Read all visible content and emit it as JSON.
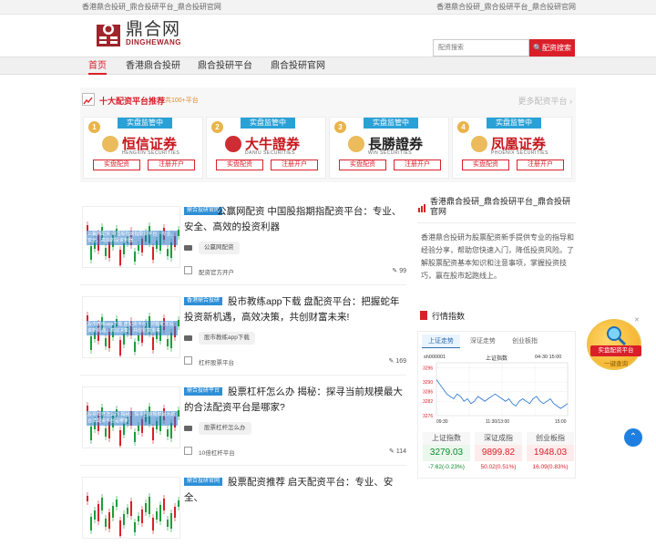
{
  "topbar": {
    "left": "香港鼎合投研_鼎合投研平台_鼎合投研官网",
    "right": "香港鼎合投研_鼎合投研平台_鼎合投研官网"
  },
  "logo": {
    "cn": "鼎合网",
    "en": "DINGHEWANG"
  },
  "search": {
    "placeholder": "配资搜索",
    "button": "🔍配资搜索"
  },
  "nav": [
    "首页",
    "香港鼎合投研",
    "鼎合投研平台",
    "鼎合投研官网"
  ],
  "promo": {
    "title": "十大配资平台推荐",
    "count": "共100+平台",
    "more": "更多配资平台"
  },
  "cards": [
    {
      "num": "1",
      "tag": "实盘监管中",
      "name": "恒信证券",
      "en": "HENGXIN SECURITIES",
      "btn1": "实盘配资",
      "btn2": "注册开户",
      "color": "#c8161d"
    },
    {
      "num": "2",
      "tag": "实盘监管中",
      "name": "大牛證券",
      "en": "DANIU SECURITIES",
      "btn1": "实盘配资",
      "btn2": "注册开户",
      "color": "#c8161d"
    },
    {
      "num": "3",
      "tag": "实盘监管中",
      "name": "長勝證券",
      "en": "WIN SECURITIES",
      "btn1": "实盘配资",
      "btn2": "注册开户",
      "color": "#222"
    },
    {
      "num": "4",
      "tag": "实盘监管中",
      "name": "凤凰证券",
      "en": "PHOENIX SECURITIES",
      "btn1": "实盘配资",
      "btn2": "注册开户",
      "color": "#c8161d"
    }
  ],
  "articles": [
    {
      "badge": "鼎合投研官网",
      "title": "公赢网配资 中国股指期指配资平台：专业、安全、高效的投资利器",
      "thumb": "公赢网配资 中国股指期指配资平台：专业、安全、高效的投资利器",
      "tag": "公赢网配资",
      "source": "配资官方开户",
      "views": "99"
    },
    {
      "badge": "香港鼎合投研",
      "title": "股市教练app下载 盘配资平台：把握蛇年投资新机遇，高效决策，共创财富未来!",
      "thumb": "股市教练app下载 盘配资平台：把握蛇年投资新机遇，高效决策，共创财富未来",
      "tag": "股市教练app下载",
      "source": "杠杆股票平台",
      "views": "169"
    },
    {
      "badge": "鼎合投研平台",
      "title": "股票杠杆怎么办 揭秘：探寻当前规模最大的合法配资平台是哪家?",
      "thumb": "股票杠杆怎么办 揭秘：探寻当前规模最大的合法配资平台是哪家",
      "tag": "股票杠杆怎么办",
      "source": "10倍杠杆平台",
      "views": "114"
    },
    {
      "badge": "鼎合投研官网",
      "title": "股票配资推荐 启天配资平台：专业、安全、",
      "thumb": "",
      "tag": "",
      "source": "",
      "views": ""
    }
  ],
  "sidebar": {
    "title": "香港鼎合投研_鼎合投研平台_鼎合投研官网",
    "text": "香港鼎合投研为股票配资新手提供专业的指导和经验分享，帮助您快速入门，降低投资风险。了解股票配资基本知识和注意事项，掌握投资技巧，赢在股市起跑线上。"
  },
  "market": {
    "title": "行情指数",
    "tabs": [
      "上证走势",
      "深证走势",
      "创业板指"
    ],
    "chart_title": "上证指数",
    "chart_code": "sh000001",
    "chart_time": "04-30 15:00",
    "chart_data": {
      "type": "line",
      "title": "上证指数",
      "ylim": [
        3276,
        3298
      ],
      "yticks": [
        "3296",
        "3290",
        "3286",
        "3282",
        "3276"
      ],
      "xticks": [
        "09:30",
        "11:30/13:00",
        "15:00"
      ],
      "values": [
        3291,
        3289,
        3287,
        3285,
        3284,
        3283,
        3285,
        3284,
        3282,
        3283,
        3281,
        3282,
        3284,
        3283,
        3282,
        3283,
        3284,
        3285,
        3284,
        3283,
        3282,
        3283,
        3281,
        3280,
        3282,
        3283,
        3282,
        3281,
        3283,
        3284,
        3282,
        3281,
        3282,
        3283,
        3281,
        3280,
        3279,
        3280,
        3281
      ]
    },
    "indices": [
      {
        "name": "上证指数",
        "value": "3279.03",
        "change": "-7.62(-0.23%)"
      },
      {
        "name": "深证成指",
        "value": "9899.82",
        "change": "50.02(0.51%)"
      },
      {
        "name": "创业板指",
        "value": "1948.03",
        "change": "16.09(0.83%)"
      }
    ]
  },
  "float": {
    "text": "实盘配资平台",
    "sub": "一键查询",
    "close": "✕"
  },
  "up": "⌃"
}
